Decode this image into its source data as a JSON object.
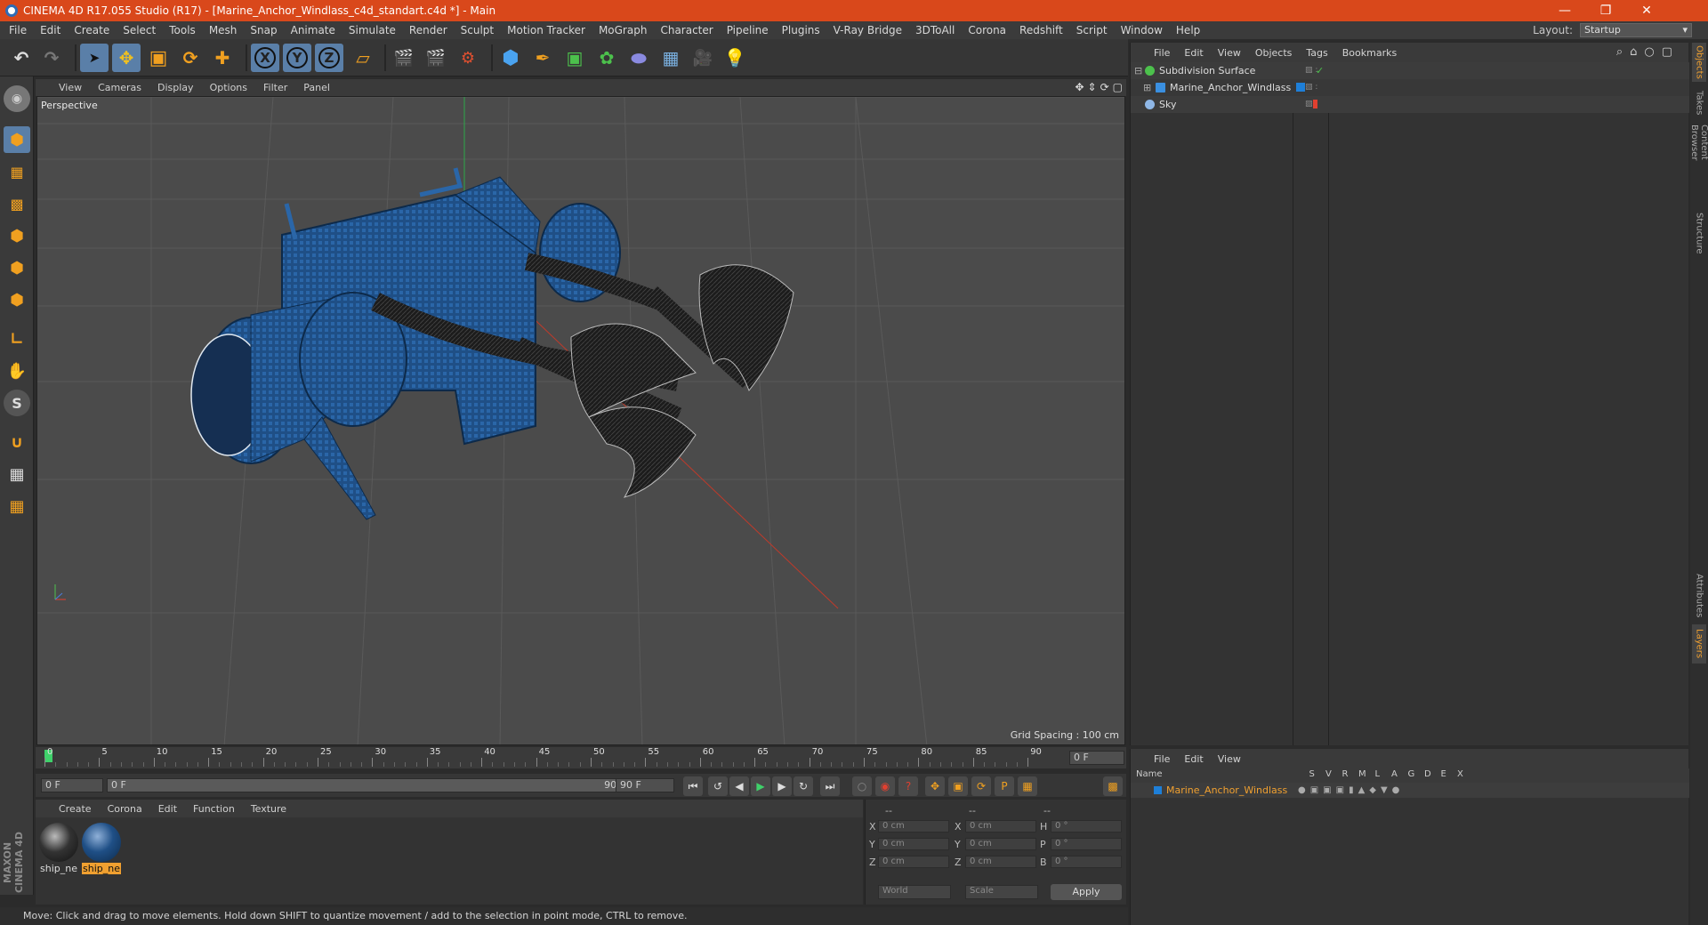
{
  "window": {
    "title": "CINEMA 4D R17.055 Studio (R17) - [Marine_Anchor_Windlass_c4d_standart.c4d *] - Main"
  },
  "menu": [
    "File",
    "Edit",
    "Create",
    "Select",
    "Tools",
    "Mesh",
    "Snap",
    "Animate",
    "Simulate",
    "Render",
    "Sculpt",
    "Motion Tracker",
    "MoGraph",
    "Character",
    "Pipeline",
    "Plugins",
    "V-Ray Bridge",
    "3DToAll",
    "Corona",
    "Redshift",
    "Script",
    "Window",
    "Help"
  ],
  "layout": {
    "label": "Layout:",
    "value": "Startup"
  },
  "toolbar": {
    "icons": [
      "undo-icon",
      "redo-icon",
      "select-icon",
      "move-icon",
      "scale-icon",
      "rotate-icon",
      "transform-icon",
      "x-axis-icon",
      "y-axis-icon",
      "z-axis-icon",
      "coord-system-icon",
      "render-view-icon",
      "render-picture-queue-icon",
      "render-settings-icon",
      "cube-icon",
      "pen-icon",
      "subdivision-icon",
      "cloner-icon",
      "deformer-icon",
      "floor-icon",
      "camera-icon",
      "light-icon"
    ],
    "axis_labels": [
      "X",
      "Y",
      "Z"
    ]
  },
  "viewport": {
    "menu": [
      "View",
      "Cameras",
      "Display",
      "Options",
      "Filter",
      "Panel"
    ],
    "label": "Perspective",
    "grid_spacing": "Grid Spacing : 100 cm"
  },
  "timeline": {
    "ticks": [
      "0",
      "5",
      "10",
      "15",
      "20",
      "25",
      "30",
      "35",
      "40",
      "45",
      "50",
      "55",
      "60",
      "65",
      "70",
      "75",
      "80",
      "85",
      "90"
    ],
    "current_frame": "0 F",
    "start": "0 F",
    "slider_left": "0 F",
    "slider_right": "90 F",
    "end": "90 F"
  },
  "materials": {
    "menu": [
      "Create",
      "Corona",
      "Edit",
      "Function",
      "Texture"
    ],
    "items": [
      {
        "label": "ship_ne",
        "selected": false
      },
      {
        "label": "ship_ne",
        "selected": true
      }
    ]
  },
  "coords": {
    "headers": [
      "--",
      "--",
      "--"
    ],
    "rows": [
      {
        "a": "X",
        "av": "0 cm",
        "b": "X",
        "bv": "0 cm",
        "c": "H",
        "cv": "0 °"
      },
      {
        "a": "Y",
        "av": "0 cm",
        "b": "Y",
        "bv": "0 cm",
        "c": "P",
        "cv": "0 °"
      },
      {
        "a": "Z",
        "av": "0 cm",
        "b": "Z",
        "bv": "0 cm",
        "c": "B",
        "cv": "0 °"
      }
    ],
    "space": "World",
    "mode": "Scale",
    "apply": "Apply"
  },
  "objects": {
    "menu": [
      "File",
      "Edit",
      "View",
      "Objects",
      "Tags",
      "Bookmarks"
    ],
    "items": [
      {
        "name": "Subdivision Surface",
        "icon": "subdivision-icon",
        "color": "#4cc14c"
      },
      {
        "name": "Marine_Anchor_Windlass",
        "icon": "null-object-icon",
        "color": "#3a8fe0"
      },
      {
        "name": "Sky",
        "icon": "sky-icon",
        "color": "#8fb7e6"
      }
    ]
  },
  "layers": {
    "menu": [
      "File",
      "Edit",
      "View"
    ],
    "headers": [
      "Name",
      "S",
      "V",
      "R",
      "M",
      "L",
      "A",
      "G",
      "D",
      "E",
      "X"
    ],
    "items": [
      {
        "name": "Marine_Anchor_Windlass",
        "color": "#1e7fd8"
      }
    ]
  },
  "right_tabs": [
    "Objects",
    "Takes",
    "Content Browser",
    "Structure",
    "Attributes",
    "Layers"
  ],
  "status": "Move: Click and drag to move elements. Hold down SHIFT to quantize movement / add to the selection in point mode, CTRL to remove.",
  "brand": "MAXON CINEMA 4D",
  "colors": {
    "accent": "#d9481b",
    "selection": "#f0a030",
    "model_blue": "#1f4f86"
  }
}
